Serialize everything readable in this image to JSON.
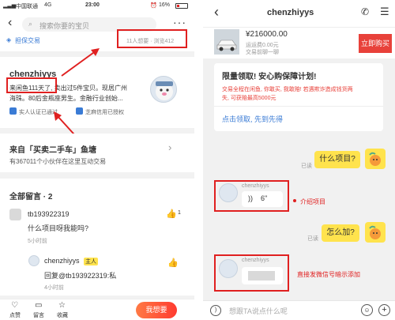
{
  "left": {
    "status": {
      "carrier": "中国联通",
      "network": "4G",
      "time": "23:00",
      "battery": "16%"
    },
    "search": {
      "placeholder": "搜索你要的宝贝"
    },
    "protect": {
      "label": "担保交易"
    },
    "stats": {
      "text": "11人想要 · 浏览412"
    },
    "seller": {
      "name": "chenzhiyys",
      "bio_line1": "来闲鱼111天了, 卖出过5件宝贝。现居广州",
      "bio_line2": "海珠。80后金瓶座男生。金融行业创始...",
      "badges": [
        "实人认证已通过",
        "芝麻信用已授权"
      ]
    },
    "pond": {
      "title": "来自「买卖二手车」鱼塘",
      "subtitle": "有367011个小伙伴在这里互动交易"
    },
    "comments": {
      "header": "全部留言 · 2",
      "items": [
        {
          "user": "tb193922319",
          "text": "什么项目呀我能吗?",
          "time": "5小时前"
        },
        {
          "user": "chenzhiyys",
          "tag": "主人",
          "text": "回复@tb193922319:私",
          "time": "4小时前"
        }
      ]
    },
    "bottom": {
      "actions": [
        "点赞",
        "留言",
        "收藏"
      ],
      "cta": "我想要"
    }
  },
  "right": {
    "title": "chenzhiyys",
    "product": {
      "price": "¥216000.00",
      "shipping": "运运费0.00元",
      "note": "交易前聊一聊",
      "buy": "立即购买"
    },
    "promo": {
      "title": "限量领取! 安心购保障计划!",
      "line1": "交易全程在闲鱼, 你敢买, 我敢赔! 若遇欺诈造成钱货两",
      "line2": "失, 可获赔最高5000元",
      "link": "点击领取, 先到先得"
    },
    "messages": [
      {
        "side": "right",
        "status": "已读",
        "text": "什么项目?"
      },
      {
        "side": "left",
        "sender": "chenzhiyys",
        "text": "6\"",
        "annotation": "介绍项目"
      },
      {
        "side": "right",
        "status": "已读",
        "text": "怎么加?"
      },
      {
        "side": "left",
        "sender": "chenzhiyys",
        "text": "",
        "annotation": "直接发微信号暗示添加"
      }
    ],
    "input": {
      "placeholder": "想跟TA说点什么呢"
    }
  },
  "colors": {
    "accent_red": "#e02020",
    "brand_yellow": "#ffe34d",
    "cta_red": "#e8413a",
    "link_blue": "#3a7bd5"
  }
}
